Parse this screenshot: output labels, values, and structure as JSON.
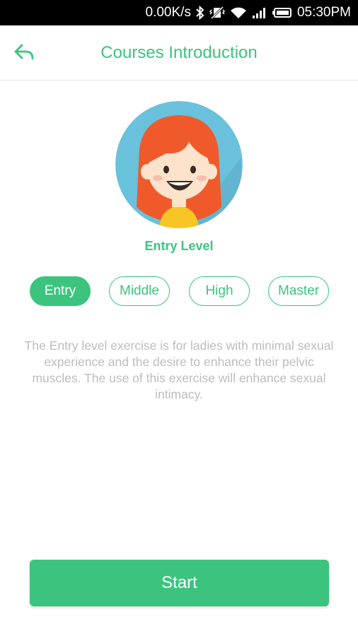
{
  "status_bar": {
    "speed": "0.00K/s",
    "icons": [
      "bluetooth-icon",
      "vibrate-icon",
      "wifi-icon",
      "signal-icon",
      "battery-icon"
    ],
    "time": "05:30PM"
  },
  "header": {
    "back_icon": "back-arrow-icon",
    "title": "Courses Introduction"
  },
  "course": {
    "avatar": "girl-avatar-illustration",
    "level_title": "Entry Level",
    "tabs": [
      {
        "label": "Entry",
        "active": true
      },
      {
        "label": "Middle",
        "active": false
      },
      {
        "label": "High",
        "active": false
      },
      {
        "label": "Master",
        "active": false
      }
    ],
    "description": "The Entry level exercise is for ladies with minimal sexual experience and the desire to enhance their pelvic muscles. The use of this exercise will enhance sexual intimacy."
  },
  "actions": {
    "start_label": "Start"
  },
  "colors": {
    "accent": "#3cc47e",
    "description_text": "#bdbdbd",
    "status_bar_bg": "#000000",
    "avatar_bg": "#6ac1dc",
    "hair": "#f05a2a",
    "shirt": "#f8c624"
  }
}
